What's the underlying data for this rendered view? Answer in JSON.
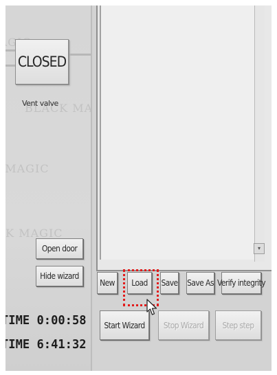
{
  "watermark_text": "BLACK MAGIC",
  "vent": {
    "status_button": "CLOSED",
    "label": "Vent valve"
  },
  "door_panel": {
    "open_door": "Open door",
    "hide_wizard": "Hide wizard"
  },
  "timers": [
    {
      "text": "TIME 0:00:58"
    },
    {
      "text": "TIME 6:41:32"
    }
  ],
  "wizard": {
    "file_buttons": {
      "new": "New",
      "load": "Load",
      "save": "Save",
      "save_as": "Save As",
      "verify": "Verify integrity"
    },
    "run_buttons": {
      "start": "Start Wizard",
      "stop": "Stop Wizard",
      "step": "Step step"
    }
  },
  "colors": {
    "highlight": "#e21b1b",
    "background": "#d6d6d6"
  }
}
